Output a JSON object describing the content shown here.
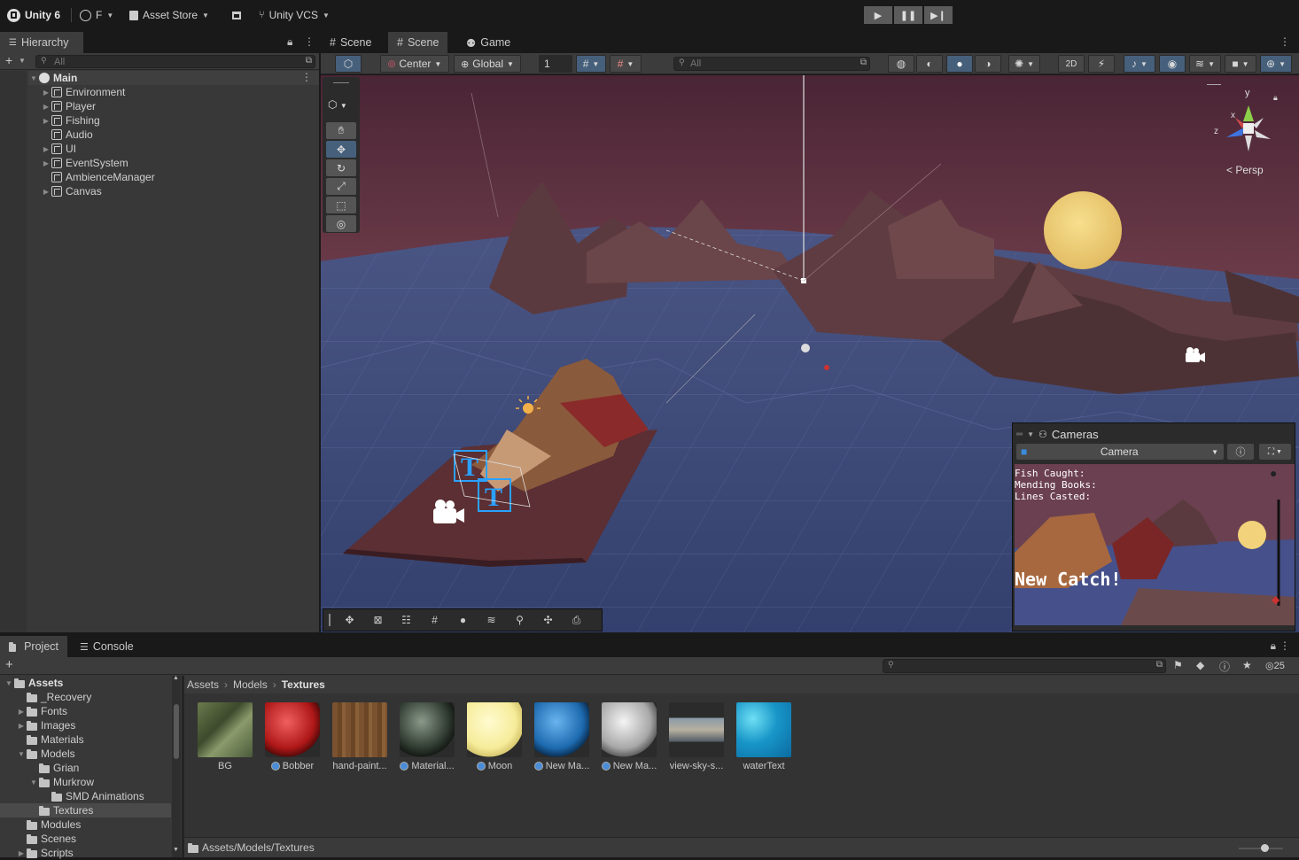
{
  "topbar": {
    "unity_label": "Unity 6",
    "account_label": "F",
    "asset_store_label": "Asset Store",
    "vcs_label": "Unity VCS",
    "play_icon": "play-icon",
    "pause_icon": "pause-icon",
    "step_icon": "step-icon"
  },
  "hierarchy": {
    "tab_label": "Hierarchy",
    "search_placeholder": "All",
    "scene_name": "Main",
    "items": [
      {
        "label": "Environment",
        "expandable": true
      },
      {
        "label": "Player",
        "expandable": true
      },
      {
        "label": "Fishing",
        "expandable": true
      },
      {
        "label": "Audio",
        "expandable": false
      },
      {
        "label": "UI",
        "expandable": true
      },
      {
        "label": "EventSystem",
        "expandable": true
      },
      {
        "label": "AmbienceManager",
        "expandable": false
      },
      {
        "label": "Canvas",
        "expandable": true
      }
    ]
  },
  "scene_tabs": [
    {
      "label": "Scene",
      "active": false
    },
    {
      "label": "Scene",
      "active": true
    },
    {
      "label": "Game",
      "active": false
    }
  ],
  "scene_toolbar": {
    "pivot_label": "Center",
    "space_label": "Global",
    "grid_value": "1",
    "search_placeholder": "All"
  },
  "scene_view": {
    "persp_label": "Persp",
    "gizmo_axes": {
      "y": "y",
      "x": "x",
      "z": "z"
    }
  },
  "cameras_overlay": {
    "title": "Cameras",
    "selected_camera": "Camera",
    "preview_lines": [
      "Fish Caught:",
      "Mending Books:",
      "Lines Casted:"
    ],
    "preview_banner": "New Catch!"
  },
  "bottom_tabs": [
    {
      "label": "Project",
      "active": true
    },
    {
      "label": "Console",
      "active": false
    }
  ],
  "project_tree": [
    {
      "label": "Assets",
      "depth": 0,
      "expanded": true,
      "selected": false,
      "bold": true
    },
    {
      "label": "_Recovery",
      "depth": 1,
      "expanded": false,
      "selected": false
    },
    {
      "label": "Fonts",
      "depth": 1,
      "expanded": false,
      "selected": false,
      "arrow": true
    },
    {
      "label": "Images",
      "depth": 1,
      "expanded": false,
      "selected": false,
      "arrow": true
    },
    {
      "label": "Materials",
      "depth": 1,
      "expanded": false,
      "selected": false
    },
    {
      "label": "Models",
      "depth": 1,
      "expanded": true,
      "selected": false,
      "arrow": true
    },
    {
      "label": "Grian",
      "depth": 2,
      "expanded": false,
      "selected": false
    },
    {
      "label": "Murkrow",
      "depth": 2,
      "expanded": true,
      "selected": false,
      "arrow": true
    },
    {
      "label": "SMD Animations",
      "depth": 3,
      "expanded": false,
      "selected": false
    },
    {
      "label": "Textures",
      "depth": 2,
      "expanded": false,
      "selected": true
    },
    {
      "label": "Modules",
      "depth": 1,
      "expanded": false,
      "selected": false
    },
    {
      "label": "Scenes",
      "depth": 1,
      "expanded": false,
      "selected": false
    },
    {
      "label": "Scripts",
      "depth": 1,
      "expanded": false,
      "selected": false,
      "arrow": true
    }
  ],
  "breadcrumb": [
    "Assets",
    "Models",
    "Textures"
  ],
  "assets": [
    {
      "label": "BG",
      "kind": "texture-bg",
      "badge": false
    },
    {
      "label": "Bobber",
      "kind": "sphere-red",
      "badge": true
    },
    {
      "label": "hand-paint...",
      "kind": "texture-wood",
      "badge": false
    },
    {
      "label": "Material...",
      "kind": "sphere-dark",
      "badge": true
    },
    {
      "label": "Moon",
      "kind": "sphere-yellow",
      "badge": true
    },
    {
      "label": "New Ma...",
      "kind": "sphere-blue",
      "badge": true
    },
    {
      "label": "New Ma...",
      "kind": "sphere-grey",
      "badge": true
    },
    {
      "label": "view-sky-s...",
      "kind": "texture-sky",
      "badge": false
    },
    {
      "label": "waterText",
      "kind": "texture-water",
      "badge": false
    }
  ],
  "status_path": "Assets/Models/Textures",
  "hidden_count": "25",
  "colors": {
    "accent_blue": "#46607c",
    "panel_bg": "#383838",
    "sea": "#3b4a7a",
    "sky": "#5c3243",
    "moon": "#f2d27a"
  }
}
